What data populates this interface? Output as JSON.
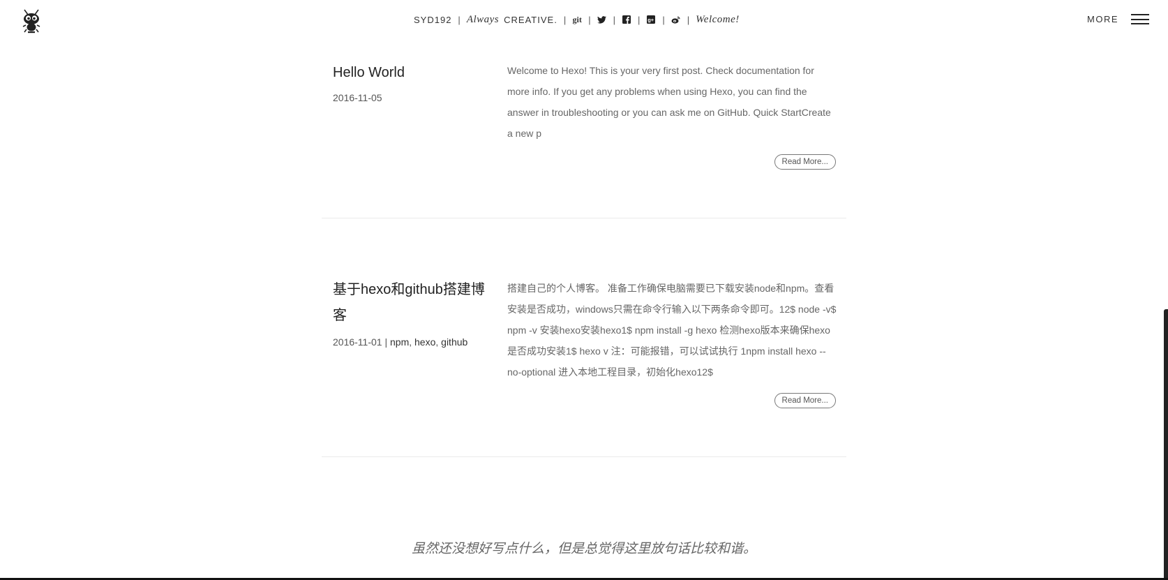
{
  "header": {
    "site_name": "SYD192",
    "slogan_italic": "Always",
    "slogan_caps": "CREATIVE.",
    "welcome": "Welcome!",
    "more_label": "MORE",
    "social_icons": [
      "git-icon",
      "twitter-icon",
      "facebook-icon",
      "google-plus-icon",
      "weibo-icon"
    ],
    "git_text": "git"
  },
  "posts": [
    {
      "title": "Hello World",
      "date": "2016-11-05",
      "tags": [],
      "excerpt": "Welcome to Hexo! This is your very first post. Check documentation for more info. If you get any problems when using Hexo, you can find the answer in troubleshooting or you can ask me on GitHub. Quick StartCreate a new p",
      "read_more": "Read More..."
    },
    {
      "title": "基于hexo和github搭建博客",
      "date": "2016-11-01",
      "meta_sep": " | ",
      "tags": [
        "npm",
        "hexo",
        "github"
      ],
      "excerpt": "搭建自己的个人博客。 准备工作确保电脑需要已下载安装node和npm。查看安装是否成功，windows只需在命令行输入以下两条命令即可。12$ node -v$ npm -v 安装hexo安装hexo1$ npm install -g hexo 检测hexo版本来确保hexo是否成功安装1$ hexo v 注：可能报错，可以试试执行 1npm install hexo --no-optional 进入本地工程目录，初始化hexo12$",
      "read_more": "Read More..."
    }
  ],
  "footer": {
    "quote": "虽然还没想好写点什么，但是总觉得这里放句话比较和谐。"
  },
  "colors": {
    "text": "#333333",
    "muted": "#666666",
    "divider": "#eaeaea",
    "accent": "#222222"
  }
}
